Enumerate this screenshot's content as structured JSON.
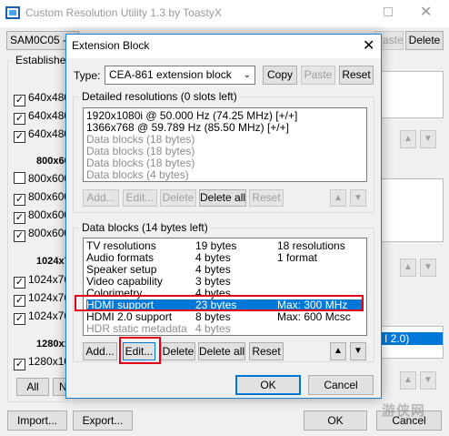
{
  "main": {
    "title": "Custom Resolution Utility 1.3 by ToastyX",
    "monitor": "SAM0C05 - S",
    "delete_label": "Delete",
    "paste_label": "Paste",
    "established_title": "Established",
    "established": [
      {
        "label": "640x480",
        "checked": true
      },
      {
        "label": "640x480",
        "checked": true
      },
      {
        "label": "640x480",
        "checked": true
      }
    ],
    "group2_title": "800x600",
    "group2": [
      {
        "label": "800x600",
        "checked": false
      },
      {
        "label": "800x600",
        "checked": true
      },
      {
        "label": "800x600",
        "checked": true
      },
      {
        "label": "800x600",
        "checked": true
      }
    ],
    "group3_title": "1024x7",
    "group3": [
      {
        "label": "1024x76",
        "checked": true
      },
      {
        "label": "1024x76",
        "checked": true
      },
      {
        "label": "1024x76",
        "checked": true
      }
    ],
    "group4_title": "1280x1",
    "group4": [
      {
        "label": "1280x10",
        "checked": true
      }
    ],
    "all_label": "All",
    "none_label": "N",
    "right_item": "I 2.0)",
    "import_label": "Import...",
    "export_label": "Export...",
    "ok_label": "OK",
    "cancel_label": "Cancel",
    "watermark": "游侠网"
  },
  "dialog": {
    "title": "Extension Block",
    "type_label": "Type:",
    "type_value": "CEA-861 extension block",
    "copy_label": "Copy",
    "paste_label": "Paste",
    "reset_label": "Reset",
    "detailed_title": "Detailed resolutions (0 slots left)",
    "detailed": [
      {
        "text": "1920x1080i @ 50.000 Hz (74.25 MHz) [+/+]",
        "gray": false
      },
      {
        "text": "1366x768 @ 59.789 Hz (85.50 MHz) [+/+]",
        "gray": false
      },
      {
        "text": "Data blocks (18 bytes)",
        "gray": true
      },
      {
        "text": "Data blocks (18 bytes)",
        "gray": true
      },
      {
        "text": "Data blocks (18 bytes)",
        "gray": true
      },
      {
        "text": "Data blocks (4 bytes)",
        "gray": true
      }
    ],
    "det_add": "Add...",
    "det_edit": "Edit...",
    "det_delete": "Delete",
    "det_delete_all": "Delete all",
    "det_reset": "Reset",
    "blocks_title": "Data blocks (14 bytes left)",
    "blocks": [
      {
        "name": "TV resolutions",
        "size": "19 bytes",
        "info": "18 resolutions",
        "selected": false,
        "gray": false
      },
      {
        "name": "Audio formats",
        "size": "4 bytes",
        "info": "1 format",
        "selected": false,
        "gray": false
      },
      {
        "name": "Speaker setup",
        "size": "4 bytes",
        "info": "",
        "selected": false,
        "gray": false
      },
      {
        "name": "Video capability",
        "size": "3 bytes",
        "info": "",
        "selected": false,
        "gray": false
      },
      {
        "name": "Colorimetry",
        "size": "4 bytes",
        "info": "",
        "selected": false,
        "gray": false
      },
      {
        "name": "HDMI support",
        "size": "23 bytes",
        "info": "Max: 300 MHz",
        "selected": true,
        "gray": false
      },
      {
        "name": "HDMI 2.0 support",
        "size": "8 bytes",
        "info": "Max: 600 Mcsc",
        "selected": false,
        "gray": false
      },
      {
        "name": "HDR static metadata",
        "size": "4 bytes",
        "info": "",
        "selected": false,
        "gray": true
      }
    ],
    "blk_add": "Add...",
    "blk_edit": "Edit...",
    "blk_delete": "Delete",
    "blk_delete_all": "Delete all",
    "blk_reset": "Reset",
    "ok_label": "OK",
    "cancel_label": "Cancel"
  },
  "colors": {
    "selection": "#0078d7",
    "highlight_box": "#e0001a",
    "dialog_border": "#1883d7"
  }
}
